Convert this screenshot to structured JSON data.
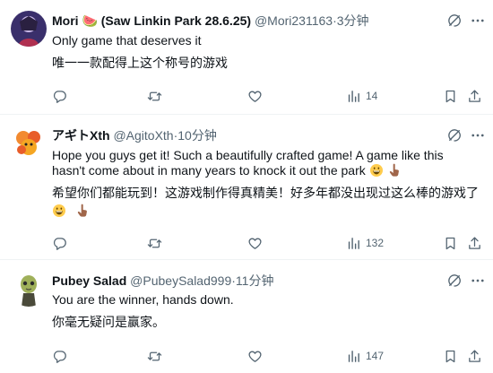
{
  "tweets": [
    {
      "name": "Mori 🍉 (Saw Linkin Park 28.6.25)",
      "handle": "@Mori231163",
      "time": "3分钟",
      "lines": [
        "Only game that deserves it",
        "唯一一款配得上这个称号的游戏"
      ],
      "views": "14"
    },
    {
      "name": "アギトXth",
      "handle": "@AgitoXth",
      "time": "10分钟",
      "lines": [
        "Hope you guys get it! Such a beautifully crafted game! A game like this",
        "hasn't come about in many years to knock it out the park",
        "希望你们都能玩到！这游戏制作得真精美！好多年都没出现过这么棒的游戏了"
      ],
      "views": "132"
    },
    {
      "name": "Pubey Salad",
      "handle": "@PubeySalad999",
      "time": "11分钟",
      "lines": [
        "You are the winner, hands down.",
        "你毫无疑问是赢家。"
      ],
      "views": "147"
    }
  ],
  "separator": "·",
  "icons": {
    "reply": "reply-icon",
    "repost": "repost-icon",
    "like": "like-icon",
    "views": "views-icon",
    "bookmark": "bookmark-icon",
    "share": "share-icon",
    "grok": "grok-icon",
    "more": "more-icon",
    "emoji_grin": "grinning-face-emoji",
    "emoji_hand": "pointing-up-emoji"
  },
  "colors": {
    "text": "#0f1419",
    "secondary": "#536471",
    "divider": "#eff3f4"
  }
}
